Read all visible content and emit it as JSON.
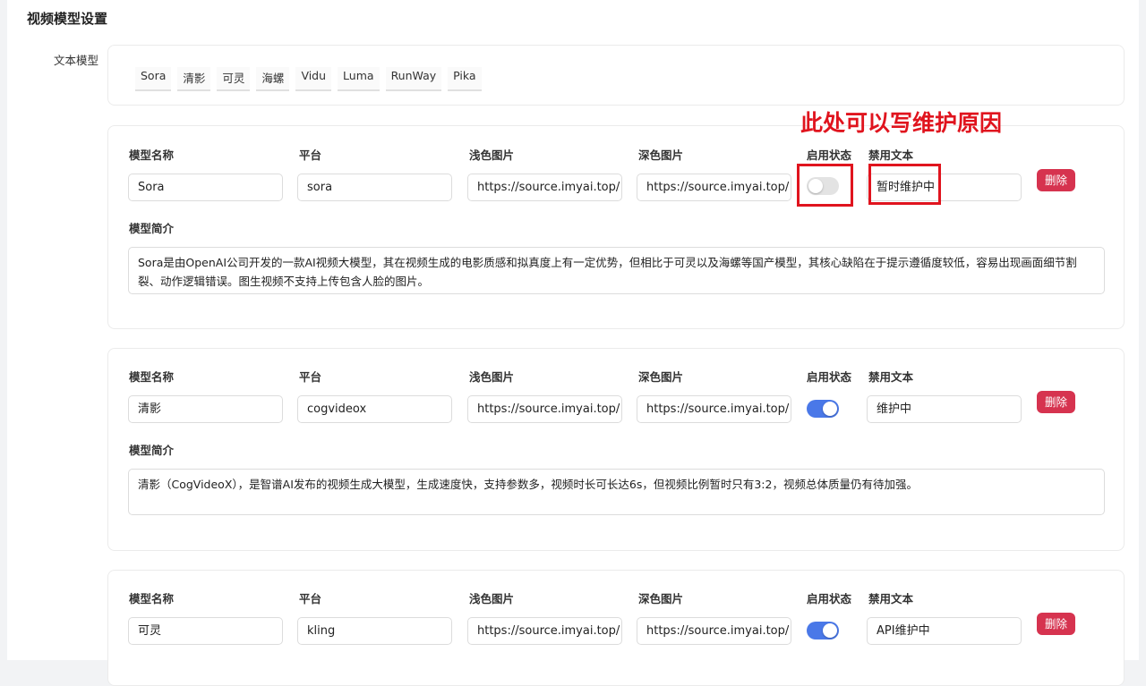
{
  "page": {
    "title": "视频模型设置",
    "row_label": "文本模型"
  },
  "tabs": [
    "Sora",
    "清影",
    "可灵",
    "海螺",
    "Vidu",
    "Luma",
    "RunWay",
    "Pika"
  ],
  "labels": {
    "name": "模型名称",
    "platform": "平台",
    "light_img": "浅色图片",
    "dark_img": "深色图片",
    "status": "启用状态",
    "disabled_text": "禁用文本",
    "intro": "模型简介",
    "delete": "删除"
  },
  "annotation": "此处可以写维护原因",
  "colors": {
    "switch_on": "#4a78e8",
    "switch_off": "#e3e3e3",
    "delete_button": "#d6334f",
    "annotation_red": "#e0141e"
  },
  "models": [
    {
      "name": "Sora",
      "platform": "sora",
      "light_img": "https://source.imyai.top/",
      "dark_img": "https://source.imyai.top/",
      "enabled": false,
      "disabled_text": "暂时维护中",
      "intro": "Sora是由OpenAI公司开发的一款AI视频大模型，其在视频生成的电影质感和拟真度上有一定优势，但相比于可灵以及海螺等国产模型，其核心缺陷在于提示遵循度较低，容易出现画面细节割裂、动作逻辑错误。图生视频不支持上传包含人脸的图片。"
    },
    {
      "name": "清影",
      "platform": "cogvideox",
      "light_img": "https://source.imyai.top/",
      "dark_img": "https://source.imyai.top/",
      "enabled": true,
      "disabled_text": "维护中",
      "intro": "清影（CogVideoX），是智谱AI发布的视频生成大模型，生成速度快，支持参数多，视频时长可长达6s，但视频比例暂时只有3:2，视频总体质量仍有待加强。"
    },
    {
      "name": "可灵",
      "platform": "kling",
      "light_img": "https://source.imyai.top/",
      "dark_img": "https://source.imyai.top/",
      "enabled": true,
      "disabled_text": "API维护中",
      "intro": ""
    }
  ]
}
